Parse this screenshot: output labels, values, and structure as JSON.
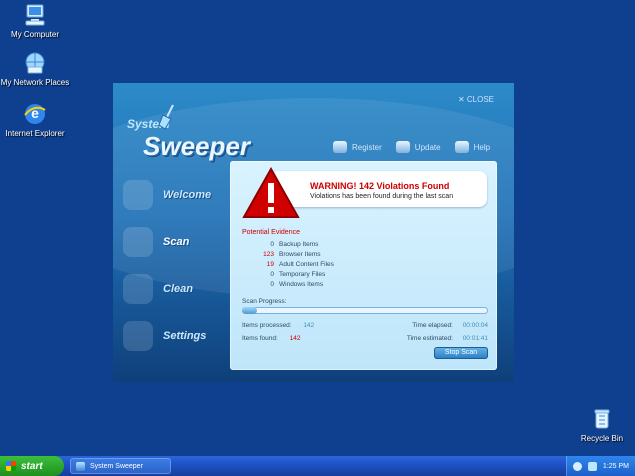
{
  "desktop": {
    "icons": [
      {
        "label": "My Computer"
      },
      {
        "label": "My Network Places"
      },
      {
        "label": "Internet Explorer"
      },
      {
        "label": "Recycle Bin"
      }
    ]
  },
  "app": {
    "title_system": "System",
    "title_sweeper": "Sweeper",
    "close_label": "CLOSE",
    "top_links": {
      "register": "Register",
      "update": "Update",
      "help": "Help"
    },
    "nav": {
      "welcome": "Welcome",
      "scan": "Scan",
      "clean": "Clean",
      "settings": "Settings"
    },
    "warning": {
      "title": "WARNING! 142 Violations Found",
      "subtitle": "Violations has been found during the last scan"
    },
    "evidence_title": "Potential Evidence",
    "evidence": [
      {
        "count": "0",
        "name": "Backup Items"
      },
      {
        "count": "123",
        "name": "Browser Items"
      },
      {
        "count": "19",
        "name": "Adult Content Files"
      },
      {
        "count": "0",
        "name": "Temporary Files"
      },
      {
        "count": "0",
        "name": "Windows Items"
      }
    ],
    "scan_progress_label": "Scan Progress:",
    "scan_progress_fraction": 0.06,
    "items_processed_label": "Items processed:",
    "items_processed_value": "142",
    "items_found_label": "Items found:",
    "items_found_value": "142",
    "time_elapsed_label": "Time elapsed:",
    "time_elapsed_value": "00:00:04",
    "time_estimated_label": "Time estimated:",
    "time_estimated_value": "00:01:41",
    "stop_scan_label": "Stop Scan"
  },
  "taskbar": {
    "start_label": "start",
    "task_label": "System Sweeper",
    "clock": "1:25 PM"
  },
  "colors": {
    "desktop_bg": "#0f3f8f",
    "warning_red": "#cc0000",
    "accent_blue": "#2b7cc0"
  }
}
